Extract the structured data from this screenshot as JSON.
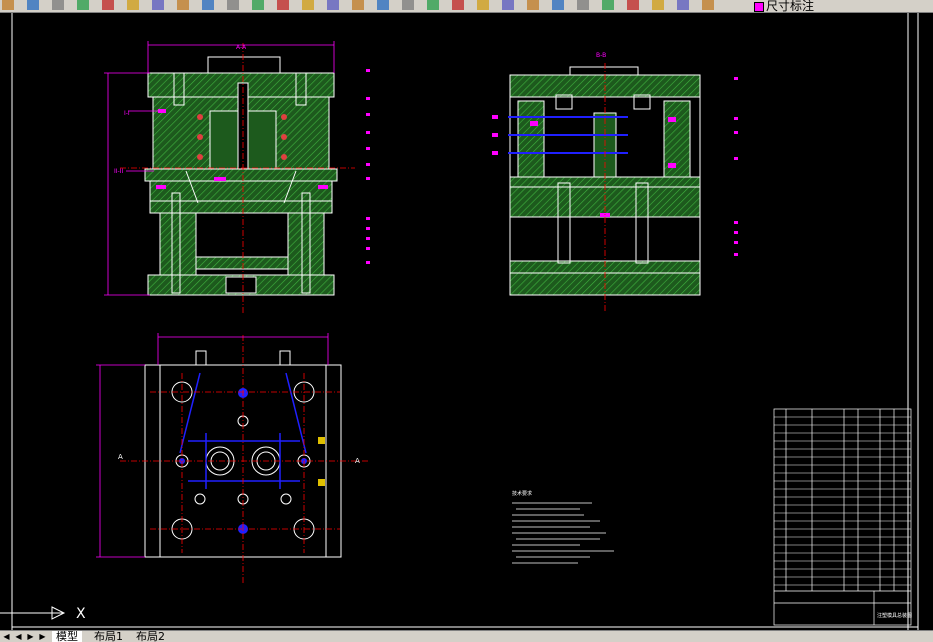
{
  "toolbar": {
    "icons": [
      "open-icon",
      "save-icon",
      "print-icon",
      "preview-icon",
      "publish-icon",
      "cut-icon",
      "copy-icon",
      "paste-icon",
      "match-properties-icon",
      "block-editor-icon",
      "undo-icon",
      "redo-icon",
      "pan-icon",
      "zoom-realtime-icon",
      "zoom-window-icon",
      "zoom-previous-icon",
      "zoom-extents-icon",
      "properties-icon",
      "design-center-icon",
      "tool-palette-icon",
      "sheet-set-icon",
      "markup-icon",
      "calculator-icon",
      "help-icon",
      "layer-manager-icon",
      "layer-on-icon",
      "layer-freeze-icon",
      "layer-lock-icon",
      "layer-color-icon"
    ],
    "layer_name": "尺寸标注",
    "layer_color": "#ff00ff"
  },
  "drawing": {
    "colors": {
      "background": "#000000",
      "outline": "#ffffff",
      "hatch": "#2f8f2f",
      "dimension": "#ff00ff",
      "center_line": "#ff0000",
      "hidden": "#0000ff",
      "plate": "#ffffff"
    },
    "section_labels": {
      "aa": "A-A",
      "bb": "B-B",
      "i": "I-I",
      "ii": "II-II",
      "left_a": "A",
      "right_a": "A"
    },
    "notes_title": "技术要求",
    "title_block": {
      "title": "注塑模具总装图"
    }
  },
  "ucs": {
    "x_label": "X"
  },
  "tabs": {
    "items": [
      {
        "label": "模型",
        "active": true
      },
      {
        "label": "布局1",
        "active": false
      },
      {
        "label": "布局2",
        "active": false
      }
    ]
  }
}
